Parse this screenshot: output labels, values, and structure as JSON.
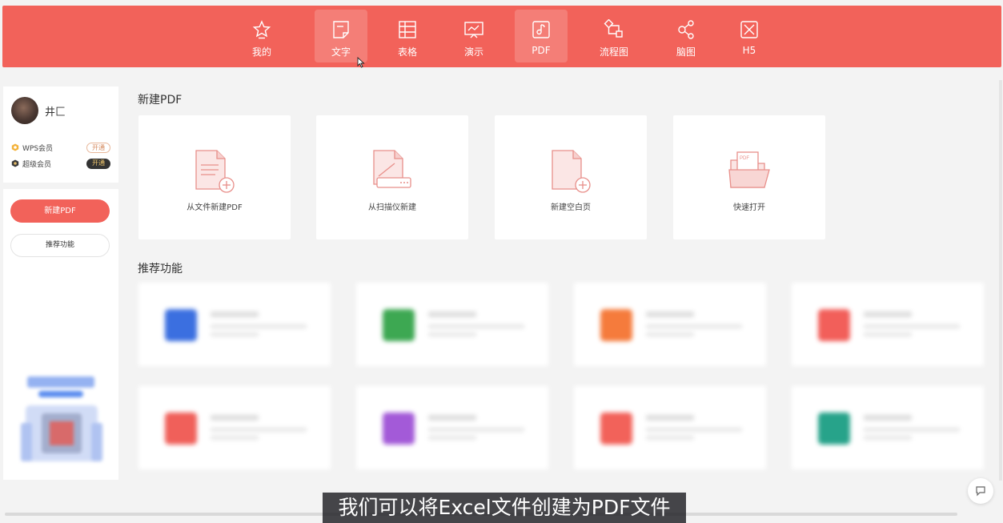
{
  "nav": {
    "items": [
      {
        "id": "mine",
        "label": "我的",
        "icon": "star-icon"
      },
      {
        "id": "doc",
        "label": "文字",
        "icon": "document-icon",
        "active": true
      },
      {
        "id": "sheet",
        "label": "表格",
        "icon": "table-icon"
      },
      {
        "id": "slide",
        "label": "演示",
        "icon": "presentation-icon"
      },
      {
        "id": "pdf",
        "label": "PDF",
        "icon": "pdf-icon",
        "active": true
      },
      {
        "id": "flow",
        "label": "流程图",
        "icon": "flowchart-icon"
      },
      {
        "id": "mind",
        "label": "脑图",
        "icon": "mindmap-icon"
      },
      {
        "id": "h5",
        "label": "H5",
        "icon": "h5-icon"
      }
    ]
  },
  "user": {
    "name": "井匚",
    "memberships": [
      {
        "label": "WPS会员",
        "action": "开通",
        "style": "light",
        "icon": "wps-member-icon"
      },
      {
        "label": "超级会员",
        "action": "开通",
        "style": "dark",
        "icon": "super-member-icon"
      }
    ]
  },
  "sidebar": {
    "new_pdf_label": "新建PDF",
    "recommend_label": "推荐功能"
  },
  "new_section": {
    "title": "新建PDF",
    "cards": [
      {
        "label": "从文件新建PDF",
        "icon": "file-add-icon"
      },
      {
        "label": "从扫描仪新建",
        "icon": "scanner-icon"
      },
      {
        "label": "新建空白页",
        "icon": "blank-page-add-icon"
      },
      {
        "label": "快速打开",
        "icon": "folder-open-icon"
      }
    ]
  },
  "recommend_section": {
    "title": "推荐功能",
    "colors": [
      "#3b6fe0",
      "#3da852",
      "#f57b3c",
      "#f25f5a",
      "#f0605a",
      "#a35ad8",
      "#f2625a",
      "#27a38a"
    ]
  },
  "subtitle": "我们可以将Excel文件创建为PDF文件",
  "theme": {
    "accent": "#f2625a"
  }
}
